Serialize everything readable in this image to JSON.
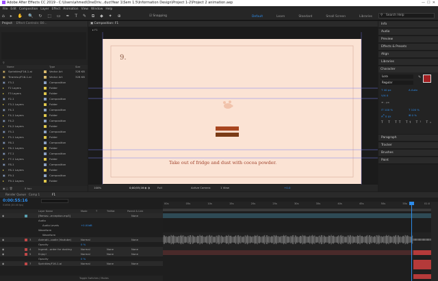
{
  "title": "Adobe After Effects CC 2019 - C:\\Users\\ahmed\\OneDriv...ductYear 1\\Sem 1.5\\Information Design\\Project 1-2\\Project 2 animation.aep",
  "menu": [
    "File",
    "Edit",
    "Composition",
    "Layer",
    "Effect",
    "Animation",
    "View",
    "Window",
    "Help"
  ],
  "toolbar": {
    "snapping": "Snapping",
    "workspaces": [
      "Default",
      "Learn",
      "Standard",
      "Small Screen",
      "Libraries"
    ],
    "search_placeholder": "Search Help"
  },
  "project": {
    "tab1": "Project",
    "tab2": "Effect Controls: B0...",
    "col_name": "Name",
    "col_type": "Type",
    "col_size": "Size",
    "items": [
      {
        "n": "Sprinkles/F16-1.ai",
        "t": "Vector Art",
        "s": "328 KB",
        "c": "#d7b86b"
      },
      {
        "n": "Tiramisu/F16-1.ai",
        "t": "Vector Art",
        "s": "328 KB",
        "c": "#d7b86b"
      },
      {
        "n": "F3-1",
        "t": "Composition",
        "s": "",
        "c": "#8aa0c4"
      },
      {
        "n": "F2 Layers",
        "t": "Folder",
        "s": "",
        "c": "#e0c84a"
      },
      {
        "n": "F3 Layers",
        "t": "Folder",
        "s": "",
        "c": "#e0c84a"
      },
      {
        "n": "F2-1",
        "t": "Composition",
        "s": "",
        "c": "#8aa0c4"
      },
      {
        "n": "F3-1 Layers",
        "t": "Folder",
        "s": "",
        "c": "#e0c84a"
      },
      {
        "n": "F4-1",
        "t": "Composition",
        "s": "",
        "c": "#8aa0c4"
      },
      {
        "n": "F4-1 Layers",
        "t": "Folder",
        "s": "",
        "c": "#e0c84a"
      },
      {
        "n": "F4-2",
        "t": "Composition",
        "s": "",
        "c": "#8aa0c4"
      },
      {
        "n": "F4-2 Layers",
        "t": "Folder",
        "s": "",
        "c": "#e0c84a"
      },
      {
        "n": "F5-1",
        "t": "Composition",
        "s": "",
        "c": "#8aa0c4"
      },
      {
        "n": "F5-1 Layers",
        "t": "Folder",
        "s": "",
        "c": "#e0c84a"
      },
      {
        "n": "F6-1",
        "t": "Composition",
        "s": "",
        "c": "#8aa0c4"
      },
      {
        "n": "F6-1 Layers",
        "t": "Folder",
        "s": "",
        "c": "#e0c84a"
      },
      {
        "n": "F7-1",
        "t": "Composition",
        "s": "",
        "c": "#8aa0c4"
      },
      {
        "n": "F7-1 Layers",
        "t": "Folder",
        "s": "",
        "c": "#e0c84a"
      },
      {
        "n": "F8-1",
        "t": "Composition",
        "s": "",
        "c": "#8aa0c4"
      },
      {
        "n": "F8-1 Layers",
        "t": "Folder",
        "s": "",
        "c": "#e0c84a"
      },
      {
        "n": "F9-1",
        "t": "Composition",
        "s": "",
        "c": "#8aa0c4"
      },
      {
        "n": "F9-1 Layers",
        "t": "Folder",
        "s": "",
        "c": "#e0c84a"
      }
    ],
    "bpc": "8 bpc"
  },
  "comp": {
    "tab": "Composition: F1",
    "breadcrumb": "F1",
    "step": "9.",
    "caption": "Take out of fridge and dust with cocoa powder.",
    "zoom": "100%",
    "time": "0;00;55;16",
    "res": "Full",
    "camera": "Active Camera",
    "view": "1 View",
    "offset": "+0.0"
  },
  "right": [
    "Info",
    "Audio",
    "Preview",
    "Effects & Presets",
    "Align",
    "Libraries"
  ],
  "character": {
    "title": "Character",
    "font": "Lora",
    "style": "Regular",
    "size": "40 px",
    "leading": "Auto",
    "tracking": "0",
    "scale_v": "100 %",
    "scale_h": "100 %",
    "baseline": "0 px",
    "tsume": "0 %",
    "unit": "- px"
  },
  "right2": [
    "Paragraph",
    "Tracker",
    "Brushes",
    "Paint"
  ],
  "timeline": {
    "tabs": [
      "Render Queue",
      "Comp 1",
      "F1"
    ],
    "timecode": "0:00:55:16",
    "fps": "01656 (30.00 fps)",
    "cols": [
      "Layer Name",
      "Mode",
      "T",
      "TrkMat",
      "Parent & Link"
    ],
    "ruler": [
      "00s",
      "05s",
      "10s",
      "15s",
      "20s",
      "25s",
      "30s",
      "35s",
      "40s",
      "45s",
      "50s",
      "55s",
      "01:0"
    ],
    "layers": [
      {
        "num": "",
        "name": "[Remov...erception.mp3]",
        "mode": "",
        "trk": "",
        "parent": "None",
        "kind": "audio"
      },
      {
        "num": "",
        "name": "Audio",
        "mode": "",
        "trk": "",
        "parent": "",
        "kind": "prop"
      },
      {
        "num": "",
        "name": "Audio Levels",
        "mode": "+0.00dB",
        "trk": "",
        "parent": "",
        "kind": "prop2"
      },
      {
        "num": "",
        "name": "Waveform",
        "mode": "",
        "trk": "",
        "parent": "",
        "kind": "prop"
      },
      {
        "num": "",
        "name": "Waveform",
        "mode": "",
        "trk": "",
        "parent": "",
        "kind": "prop2"
      },
      {
        "num": "3",
        "name": "Animati...oodle (Youtube)",
        "mode": "Normal",
        "trk": "",
        "parent": "None",
        "kind": "layer"
      },
      {
        "num": "",
        "name": "Opacity",
        "mode": "0 %",
        "trk": "",
        "parent": "",
        "kind": "prop"
      },
      {
        "num": "4",
        "name": "Ingredi...order for dusting",
        "mode": "Normal",
        "trk": "None",
        "parent": "None",
        "kind": "layer"
      },
      {
        "num": "5",
        "name": "Enjoy!",
        "mode": "Normal",
        "trk": "None",
        "parent": "None",
        "kind": "layer"
      },
      {
        "num": "",
        "name": "Opacity",
        "mode": "0 %",
        "trk": "",
        "parent": "",
        "kind": "prop"
      },
      {
        "num": "7",
        "name": "Sprinkles/F16-1.ai",
        "mode": "Normal",
        "trk": "None",
        "parent": "None",
        "kind": "layer"
      }
    ],
    "toggle": "Toggle Switches / Modes"
  },
  "colors": {
    "accent": "#2d8ceb",
    "canvas": "#fbe3d4",
    "brown": "#7a3b16",
    "red": "#a32022"
  }
}
